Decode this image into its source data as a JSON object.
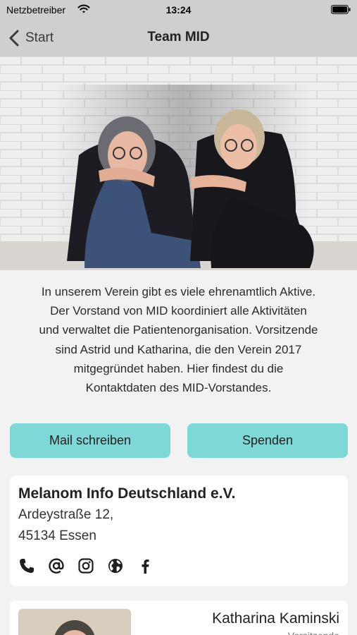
{
  "status_bar": {
    "carrier": "Netzbetreiber",
    "time": "13:24"
  },
  "nav": {
    "back_label": "Start",
    "title": "Team MID"
  },
  "intro": {
    "lines": [
      "In unserem Verein gibt es viele ehrenamtlich Aktive.",
      "Der Vorstand von MID koordiniert alle Aktivitäten",
      "und verwaltet die Patientenorganisation. Vorsitzende",
      "sind Astrid und Katharina, die den Verein 2017",
      "mitgegründet haben. Hier findest du die",
      "Kontaktdaten des MID-Vorstandes."
    ]
  },
  "buttons": {
    "mail": "Mail schreiben",
    "donate": "Spenden"
  },
  "org_card": {
    "name": "Melanom Info Deutschland e.V.",
    "street": "Ardeystraße 12,",
    "city": "45134 Essen",
    "icons": [
      "phone-icon",
      "at-icon",
      "instagram-icon",
      "globe-icon",
      "facebook-icon"
    ]
  },
  "person_card": {
    "name": "Katharina Kaminski",
    "role": "Vorsitzende"
  },
  "colors": {
    "accent": "#7dd8d6",
    "bar": "#cfcfcf",
    "background": "#f2f2f2"
  }
}
